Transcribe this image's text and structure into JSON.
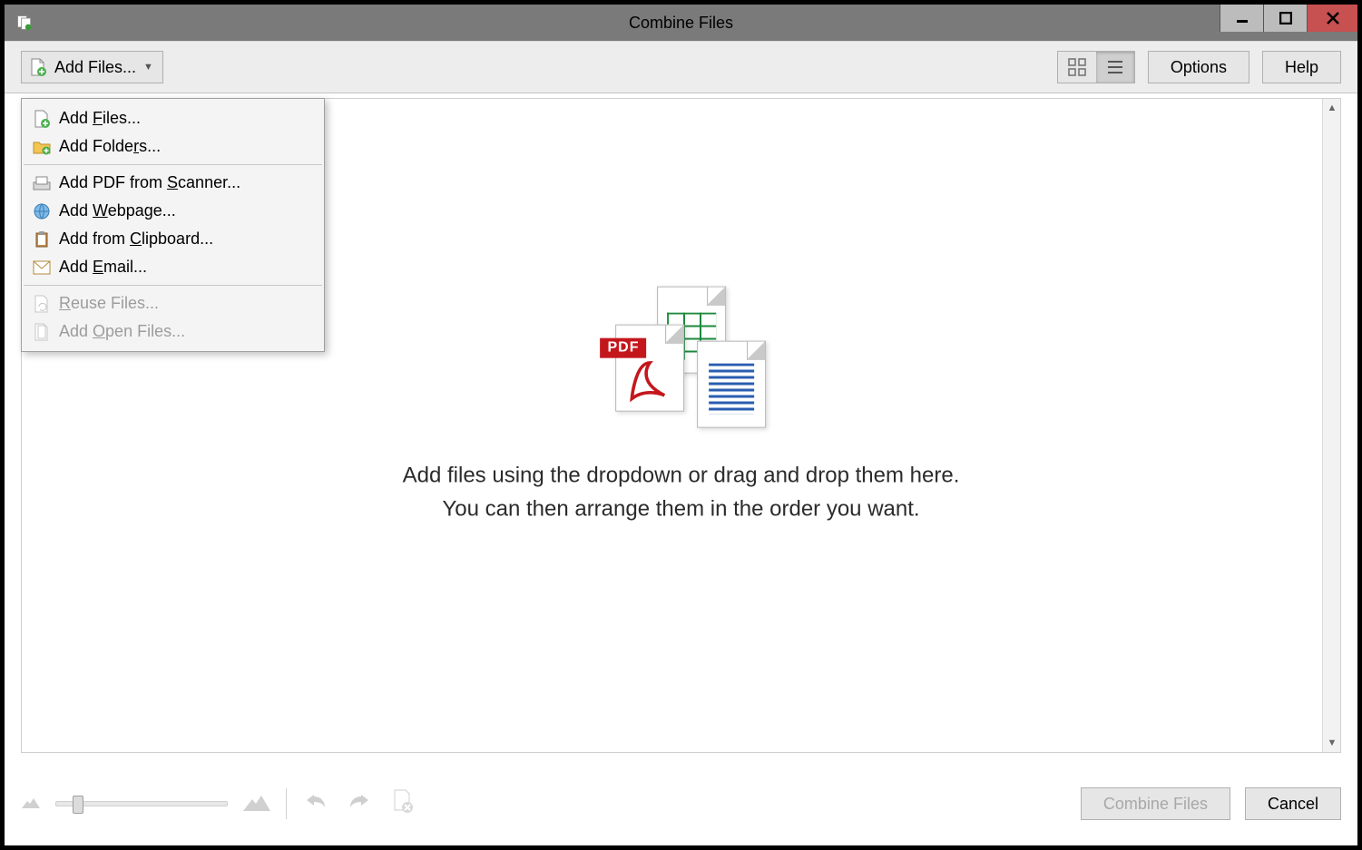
{
  "window": {
    "title": "Combine Files"
  },
  "toolbar": {
    "add_files_label": "Add Files..."
  },
  "buttons": {
    "options": "Options",
    "help": "Help",
    "combine": "Combine Files",
    "cancel": "Cancel"
  },
  "menu": {
    "add_files": "Add Files...",
    "add_folders": "Add Folders...",
    "add_scanner": "Add PDF from Scanner...",
    "add_webpage": "Add Webpage...",
    "add_clipboard": "Add from Clipboard...",
    "add_email": "Add Email...",
    "reuse_files": "Reuse Files...",
    "add_open_files": "Add Open Files...",
    "hot": {
      "add_files": "F",
      "add_folders": "r",
      "add_scanner": "S",
      "add_webpage": "W",
      "add_clipboard": "C",
      "add_email": "E",
      "reuse_files": "R",
      "add_open_files": "O"
    }
  },
  "drop": {
    "line1": "Add files using the dropdown or drag and drop them here.",
    "line2": "You can then arrange them in the order you want.",
    "pdf_badge": "PDF"
  },
  "icons": {
    "app": "combine-files-icon",
    "page_plus": "page-plus-icon",
    "folder_plus": "folder-plus-icon",
    "scanner": "scanner-icon",
    "webpage": "webpage-icon",
    "clipboard": "clipboard-icon",
    "email": "email-icon",
    "reuse": "reuse-files-icon",
    "open_files": "open-files-icon",
    "grid_view": "grid-view-icon",
    "list_view": "list-view-icon",
    "thumb_small": "thumbnail-small-icon",
    "thumb_large": "thumbnail-large-icon",
    "undo": "undo-icon",
    "redo": "redo-icon",
    "remove": "remove-file-icon"
  }
}
